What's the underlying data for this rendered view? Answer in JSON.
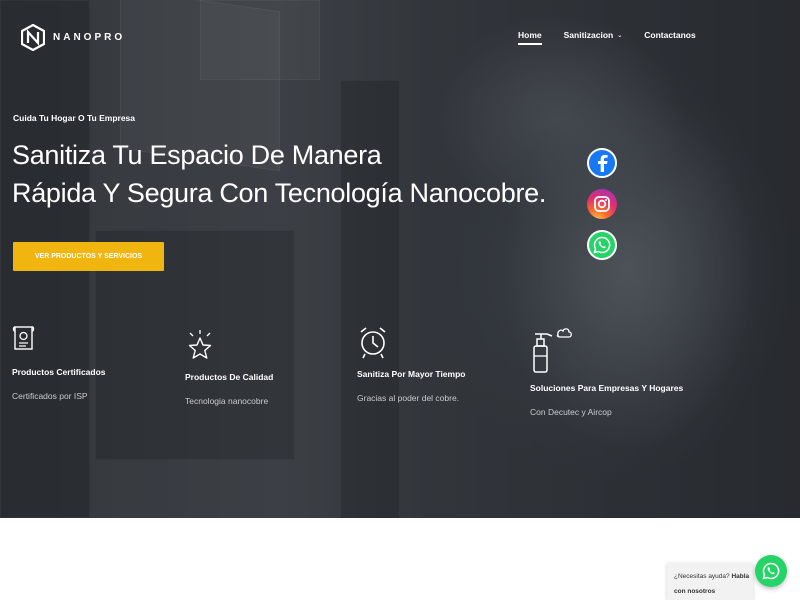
{
  "brand": {
    "name": "NANOPRO"
  },
  "nav": {
    "items": [
      {
        "label": "Home",
        "active": true
      },
      {
        "label": "Sanitizacion",
        "has_dropdown": true
      },
      {
        "label": "Contactanos"
      }
    ],
    "dropdown_glyph": "⌄"
  },
  "hero": {
    "tagline": "Cuida Tu Hogar O Tu Empresa",
    "headline_line1": "Sanitiza Tu Espacio De Manera",
    "headline_line2": "Rápida Y Segura Con Tecnología Nanocobre.",
    "cta_label": "VER PRODUCTOS Y SERVICIOS",
    "cta_color": "#f0b50f"
  },
  "social": [
    {
      "name": "facebook-icon",
      "color": "#1877f2"
    },
    {
      "name": "instagram-icon",
      "color": "#e1306c"
    },
    {
      "name": "whatsapp-icon",
      "color": "#25d366"
    }
  ],
  "features": [
    {
      "icon": "certificate-icon",
      "title": "Productos Certificados",
      "desc": "Certificados por ISP"
    },
    {
      "icon": "star-icon",
      "title": "Productos De Calidad",
      "desc": "Tecnologia nanocobre"
    },
    {
      "icon": "alarm-clock-icon",
      "title": "Sanitiza Por Mayor Tiempo",
      "desc": "Gracias al poder del cobre."
    },
    {
      "icon": "spray-bottle-icon",
      "title": "Soluciones Para Empresas Y Hogares",
      "desc": "Con Decutec y Aircop"
    }
  ],
  "chat": {
    "question": "¿Necesitas ayuda?",
    "action": "Habla con nosotros",
    "color": "#25d366"
  }
}
